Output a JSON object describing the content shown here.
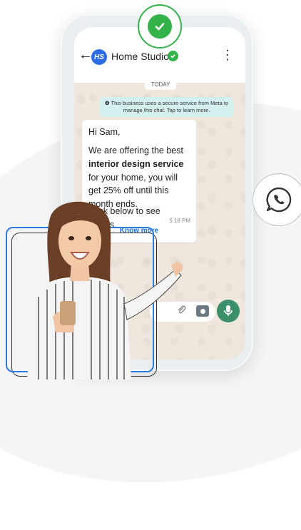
{
  "chat": {
    "business_name": "Home Studioz",
    "avatar_initials": "HS",
    "date_label": "TODAY",
    "security_notice": "This business uses a secure service from Meta to manage this chat. Tap to learn more.",
    "message": {
      "greeting": "Hi Sam,",
      "line_prefix": "We are offering the best ",
      "highlight": "interior design service",
      "line_suffix": " for your home, you will get 25% off until this month ends.",
      "cta_text": "Click below to see details.",
      "time": "5:18 PM",
      "button_label": "Know more"
    }
  },
  "icons": {
    "back": "back-arrow-icon",
    "menu": "kebab-menu-icon",
    "verified": "verified-check-icon",
    "attach": "paperclip-icon",
    "camera": "camera-icon",
    "mic": "microphone-icon",
    "whatsapp": "whatsapp-icon"
  },
  "colors": {
    "verified_green": "#33b34a",
    "link_blue": "#1a73e8",
    "frame_blue": "#2a7de0",
    "mic_green": "#3a8f6a",
    "avatar_blue": "#2b6be6",
    "notice_bg": "#d3f0ef"
  }
}
